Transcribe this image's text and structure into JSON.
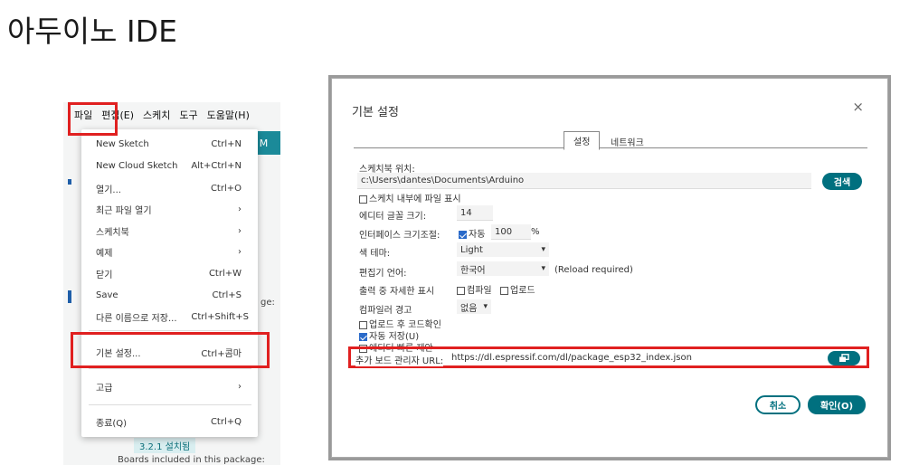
{
  "page_title": "아두이노 IDE",
  "left": {
    "menubar": [
      "파일",
      "편집(E)",
      "스케치",
      "도구",
      "도움말(H)"
    ],
    "right_tab_text": "er M",
    "background_text": {
      "frag_ge": "ge:",
      "installed_badge": "3.2.1 설치됨",
      "boards_included": "Boards included in this package:"
    },
    "file_menu": [
      {
        "label": "New Sketch",
        "shortcut": "Ctrl+N"
      },
      {
        "label": "New Cloud Sketch",
        "shortcut": "Alt+Ctrl+N"
      },
      {
        "label": "열기...",
        "shortcut": "Ctrl+O"
      },
      {
        "label": "최근 파일 열기",
        "shortcut": "›"
      },
      {
        "label": "스케치북",
        "shortcut": "›"
      },
      {
        "label": "예제",
        "shortcut": "›"
      },
      {
        "label": "닫기",
        "shortcut": "Ctrl+W"
      },
      {
        "label": "Save",
        "shortcut": "Ctrl+S"
      },
      {
        "label": "다른 이름으로 저장...",
        "shortcut": "Ctrl+Shift+S"
      },
      {
        "label": "기본 설정...",
        "shortcut": "Ctrl+콤마"
      },
      {
        "label": "고급",
        "shortcut": "›"
      },
      {
        "label": "종료(Q)",
        "shortcut": "Ctrl+Q"
      }
    ]
  },
  "dialog": {
    "title": "기본 설정",
    "close_icon": "×",
    "tabs": [
      "설정",
      "네트워크"
    ],
    "sketchbook_label": "스케치북 위치:",
    "sketchbook_path": "c:\\Users\\dantes\\Documents\\Arduino",
    "browse_button": "검색",
    "show_files_label": "스케치 내부에 파일 표시",
    "editor_font_label": "에디터 글꼴 크기:",
    "editor_font_value": "14",
    "interface_scale_label": "인터페이스 크기조절:",
    "auto_label": "자동",
    "scale_value": "100",
    "percent": "%",
    "theme_label": "색 테마:",
    "theme_value": "Light",
    "language_label": "편집기 언어:",
    "language_value": "한국어",
    "reload_note": "(Reload required)",
    "verbose_label": "출력 중 자세한 표시",
    "compile_label": "컴파일",
    "upload_label": "업로드",
    "warnings_label": "컴파일러 경고",
    "warnings_value": "없음",
    "verify_after_upload": "업로드 후 코드확인",
    "autosave": "자동 저장(U)",
    "quick_suggestions": "에디터 빠른 제안",
    "board_url_label": "추가 보드 관리자 URL:",
    "board_url_value": "https://dl.espressif.com/dl/package_esp32_index.json",
    "cancel_button": "취소",
    "ok_button": "확인(O)",
    "accent": "#00707f"
  }
}
